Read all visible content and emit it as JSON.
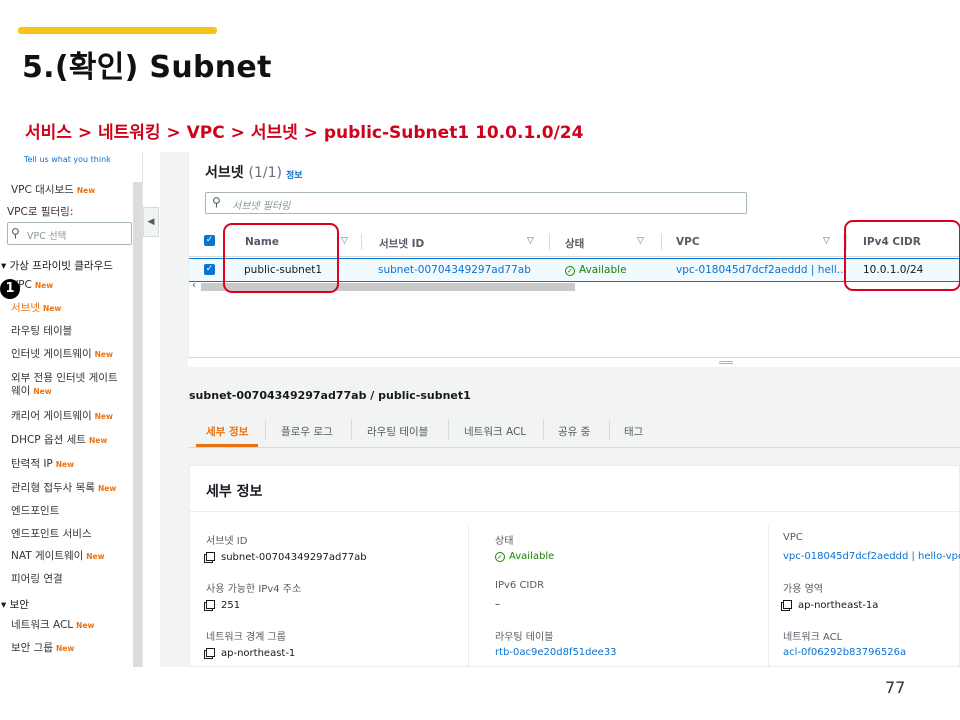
{
  "slide": {
    "title": "5.(확인) Subnet",
    "breadcrumb": "서비스 > 네트워킹 > VPC > 서브넷 > public-Subnet1   10.0.1.0/24",
    "page_number": "77",
    "accent_color": "#f7c31a",
    "highlight_color": "#e0001b"
  },
  "sidebar": {
    "feedback_link": "Tell us what you think",
    "new_badge": "New",
    "dashboard": "VPC 대시보드",
    "filter_label": "VPC로 필터링:",
    "vpc_select_placeholder": "VPC 선택",
    "section_private_cloud": "가상 프라이빗 클라우드",
    "marker": "1",
    "items": [
      {
        "label": "VPC"
      },
      {
        "label": "서브넷"
      },
      {
        "label": "라우팅 테이블"
      },
      {
        "label": "인터넷 게이트웨이"
      },
      {
        "label": "외부 전용 인터넷 게이트",
        "label2": "웨이"
      },
      {
        "label": "캐리어 게이트웨이"
      },
      {
        "label": "DHCP 옵션 세트"
      },
      {
        "label": "탄력적 IP"
      },
      {
        "label": "관리형 접두사 목록"
      },
      {
        "label": "엔드포인트"
      },
      {
        "label": "엔드포인트 서비스"
      },
      {
        "label": "NAT 게이트웨이"
      },
      {
        "label": "피어링 연결"
      }
    ],
    "section_security": "보안",
    "security_items": [
      {
        "label": "네트워크 ACL"
      },
      {
        "label": "보안 그룹"
      }
    ]
  },
  "subnet_table": {
    "title": "서브넷",
    "count": "(1/1)",
    "info_link": "정보",
    "filter_placeholder": "서브넷 필터링",
    "columns": [
      "Name",
      "서브넷 ID",
      "상태",
      "VPC",
      "IPv4 CIDR"
    ],
    "rows": [
      {
        "name": "public-subnet1",
        "subnet_id": "subnet-00704349297ad77ab",
        "state": "Available",
        "vpc": "vpc-018045d7dcf2aeddd | hell...",
        "ipv4_cidr": "10.0.1.0/24"
      }
    ]
  },
  "details": {
    "heading": "subnet-00704349297ad77ab / public-subnet1",
    "tabs": [
      "세부 정보",
      "플로우 로그",
      "라우팅 테이블",
      "네트워크 ACL",
      "공유 중",
      "태그"
    ],
    "active_tab": "세부 정보",
    "card_title": "세부 정보",
    "fields": {
      "subnet_id": {
        "label": "서브넷 ID",
        "value": "subnet-00704349297ad77ab"
      },
      "state": {
        "label": "상태",
        "value": "Available"
      },
      "vpc": {
        "label": "VPC",
        "value": "vpc-018045d7dcf2aeddd | hello-vpc"
      },
      "available_ipv4": {
        "label": "사용 가능한 IPv4 주소",
        "value": "251"
      },
      "ipv6_cidr": {
        "label": "IPv6 CIDR",
        "value": "–"
      },
      "availability_zone": {
        "label": "가용 영역",
        "value": "ap-northeast-1a"
      },
      "network_border_group": {
        "label": "네트워크 경계 그룹",
        "value": "ap-northeast-1"
      },
      "route_table": {
        "label": "라우팅 테이블",
        "value": "rtb-0ac9e20d8f51dee33"
      },
      "network_acl": {
        "label": "네트워크 ACL",
        "value": "acl-0f06292b83796526a"
      }
    }
  }
}
